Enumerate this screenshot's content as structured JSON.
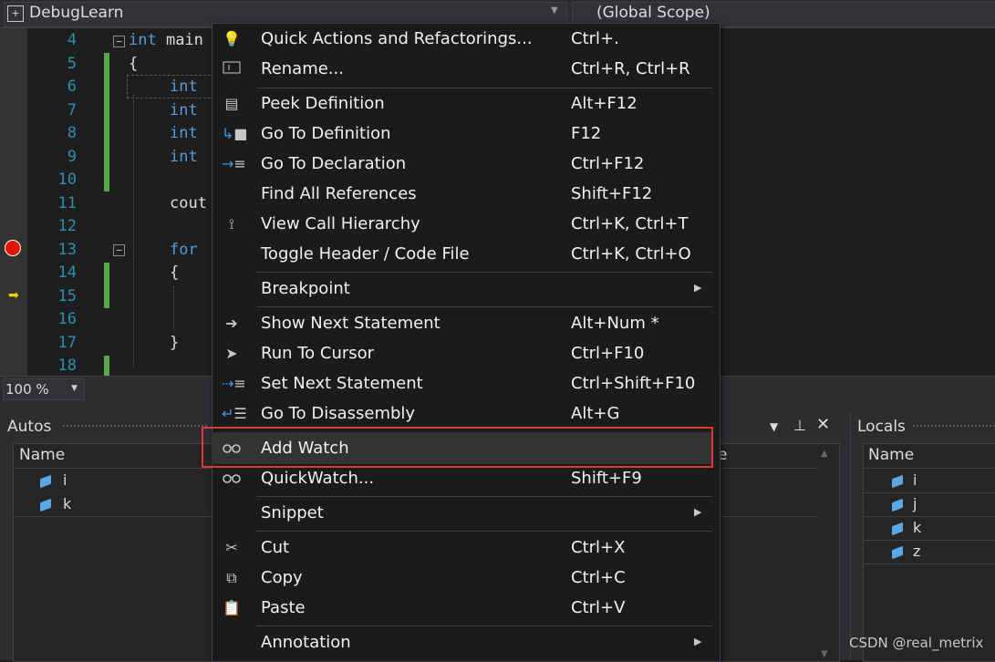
{
  "nav": {
    "project": "DebugLearn",
    "scope": "(Global Scope)"
  },
  "editor": {
    "line_numbers": [
      "4",
      "5",
      "6",
      "7",
      "8",
      "9",
      "10",
      "11",
      "12",
      "13",
      "14",
      "15",
      "16",
      "17",
      "18"
    ],
    "lines": {
      "l4_kw": "int",
      "l4_rest": " main",
      "l5": "{",
      "l6_kw": "int",
      "l7_kw": "int",
      "l8_kw": "int",
      "l9_kw": "int",
      "l11": "cout",
      "l13_kw": "for",
      "l14": "{",
      "l17": "}"
    },
    "zoom": "100 %"
  },
  "context_menu": {
    "items": [
      {
        "label": "Quick Actions and Refactorings...",
        "shortcut": "Ctrl+.",
        "icon": "lightbulb-icon"
      },
      {
        "label": "Rename...",
        "shortcut": "Ctrl+R, Ctrl+R",
        "icon": "rename-icon"
      },
      {
        "label": "Peek Definition",
        "shortcut": "Alt+F12",
        "icon": "peek-definition-icon"
      },
      {
        "label": "Go To Definition",
        "shortcut": "F12",
        "icon": "go-to-definition-icon"
      },
      {
        "label": "Go To Declaration",
        "shortcut": "Ctrl+F12",
        "icon": "go-to-declaration-icon"
      },
      {
        "label": "Find All References",
        "shortcut": "Shift+F12",
        "icon": ""
      },
      {
        "label": "View Call Hierarchy",
        "shortcut": "Ctrl+K, Ctrl+T",
        "icon": "call-hierarchy-icon"
      },
      {
        "label": "Toggle Header / Code File",
        "shortcut": "Ctrl+K, Ctrl+O",
        "icon": ""
      },
      {
        "label": "Breakpoint",
        "shortcut": "",
        "icon": "",
        "submenu": true
      },
      {
        "label": "Show Next Statement",
        "shortcut": "Alt+Num *",
        "icon": "right-arrow-icon"
      },
      {
        "label": "Run To Cursor",
        "shortcut": "Ctrl+F10",
        "icon": "cursor-icon"
      },
      {
        "label": "Set Next Statement",
        "shortcut": "Ctrl+Shift+F10",
        "icon": "set-next-statement-icon"
      },
      {
        "label": "Go To Disassembly",
        "shortcut": "Alt+G",
        "icon": "disassembly-icon"
      },
      {
        "label": "Add Watch",
        "shortcut": "",
        "icon": "glasses-icon"
      },
      {
        "label": "QuickWatch...",
        "shortcut": "Shift+F9",
        "icon": "glasses-icon"
      },
      {
        "label": "Snippet",
        "shortcut": "",
        "icon": "",
        "submenu": true
      },
      {
        "label": "Cut",
        "shortcut": "Ctrl+X",
        "icon": "scissors-icon"
      },
      {
        "label": "Copy",
        "shortcut": "Ctrl+C",
        "icon": "copy-icon"
      },
      {
        "label": "Paste",
        "shortcut": "Ctrl+V",
        "icon": "paste-icon"
      },
      {
        "label": "Annotation",
        "shortcut": "",
        "icon": "",
        "submenu": true
      }
    ]
  },
  "autos": {
    "title": "Autos",
    "column_name": "Name",
    "column_value_fragment": "e",
    "vars": [
      "i",
      "k"
    ]
  },
  "locals": {
    "title": "Locals",
    "column_name": "Name",
    "vars": [
      "i",
      "j",
      "k",
      "z"
    ]
  },
  "watermark": "CSDN @real_metrix",
  "colors": {
    "highlight_border": "#e0383a",
    "keyword": "#569cd6",
    "line_number": "#2b91af",
    "breakpoint": "#e51400"
  }
}
